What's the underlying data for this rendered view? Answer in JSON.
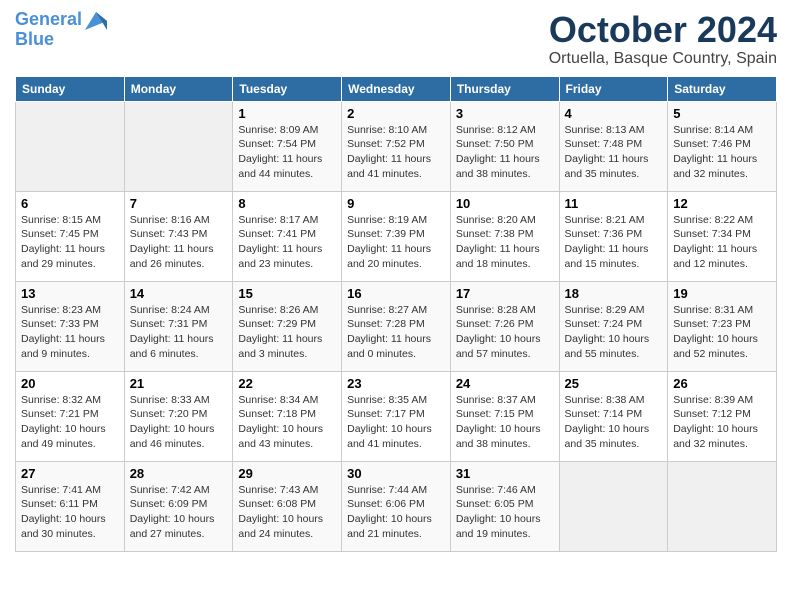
{
  "header": {
    "logo_line1": "General",
    "logo_line2": "Blue",
    "month": "October 2024",
    "location": "Ortuella, Basque Country, Spain"
  },
  "days_of_week": [
    "Sunday",
    "Monday",
    "Tuesday",
    "Wednesday",
    "Thursday",
    "Friday",
    "Saturday"
  ],
  "weeks": [
    [
      {
        "num": "",
        "info": ""
      },
      {
        "num": "",
        "info": ""
      },
      {
        "num": "1",
        "info": "Sunrise: 8:09 AM\nSunset: 7:54 PM\nDaylight: 11 hours and 44 minutes."
      },
      {
        "num": "2",
        "info": "Sunrise: 8:10 AM\nSunset: 7:52 PM\nDaylight: 11 hours and 41 minutes."
      },
      {
        "num": "3",
        "info": "Sunrise: 8:12 AM\nSunset: 7:50 PM\nDaylight: 11 hours and 38 minutes."
      },
      {
        "num": "4",
        "info": "Sunrise: 8:13 AM\nSunset: 7:48 PM\nDaylight: 11 hours and 35 minutes."
      },
      {
        "num": "5",
        "info": "Sunrise: 8:14 AM\nSunset: 7:46 PM\nDaylight: 11 hours and 32 minutes."
      }
    ],
    [
      {
        "num": "6",
        "info": "Sunrise: 8:15 AM\nSunset: 7:45 PM\nDaylight: 11 hours and 29 minutes."
      },
      {
        "num": "7",
        "info": "Sunrise: 8:16 AM\nSunset: 7:43 PM\nDaylight: 11 hours and 26 minutes."
      },
      {
        "num": "8",
        "info": "Sunrise: 8:17 AM\nSunset: 7:41 PM\nDaylight: 11 hours and 23 minutes."
      },
      {
        "num": "9",
        "info": "Sunrise: 8:19 AM\nSunset: 7:39 PM\nDaylight: 11 hours and 20 minutes."
      },
      {
        "num": "10",
        "info": "Sunrise: 8:20 AM\nSunset: 7:38 PM\nDaylight: 11 hours and 18 minutes."
      },
      {
        "num": "11",
        "info": "Sunrise: 8:21 AM\nSunset: 7:36 PM\nDaylight: 11 hours and 15 minutes."
      },
      {
        "num": "12",
        "info": "Sunrise: 8:22 AM\nSunset: 7:34 PM\nDaylight: 11 hours and 12 minutes."
      }
    ],
    [
      {
        "num": "13",
        "info": "Sunrise: 8:23 AM\nSunset: 7:33 PM\nDaylight: 11 hours and 9 minutes."
      },
      {
        "num": "14",
        "info": "Sunrise: 8:24 AM\nSunset: 7:31 PM\nDaylight: 11 hours and 6 minutes."
      },
      {
        "num": "15",
        "info": "Sunrise: 8:26 AM\nSunset: 7:29 PM\nDaylight: 11 hours and 3 minutes."
      },
      {
        "num": "16",
        "info": "Sunrise: 8:27 AM\nSunset: 7:28 PM\nDaylight: 11 hours and 0 minutes."
      },
      {
        "num": "17",
        "info": "Sunrise: 8:28 AM\nSunset: 7:26 PM\nDaylight: 10 hours and 57 minutes."
      },
      {
        "num": "18",
        "info": "Sunrise: 8:29 AM\nSunset: 7:24 PM\nDaylight: 10 hours and 55 minutes."
      },
      {
        "num": "19",
        "info": "Sunrise: 8:31 AM\nSunset: 7:23 PM\nDaylight: 10 hours and 52 minutes."
      }
    ],
    [
      {
        "num": "20",
        "info": "Sunrise: 8:32 AM\nSunset: 7:21 PM\nDaylight: 10 hours and 49 minutes."
      },
      {
        "num": "21",
        "info": "Sunrise: 8:33 AM\nSunset: 7:20 PM\nDaylight: 10 hours and 46 minutes."
      },
      {
        "num": "22",
        "info": "Sunrise: 8:34 AM\nSunset: 7:18 PM\nDaylight: 10 hours and 43 minutes."
      },
      {
        "num": "23",
        "info": "Sunrise: 8:35 AM\nSunset: 7:17 PM\nDaylight: 10 hours and 41 minutes."
      },
      {
        "num": "24",
        "info": "Sunrise: 8:37 AM\nSunset: 7:15 PM\nDaylight: 10 hours and 38 minutes."
      },
      {
        "num": "25",
        "info": "Sunrise: 8:38 AM\nSunset: 7:14 PM\nDaylight: 10 hours and 35 minutes."
      },
      {
        "num": "26",
        "info": "Sunrise: 8:39 AM\nSunset: 7:12 PM\nDaylight: 10 hours and 32 minutes."
      }
    ],
    [
      {
        "num": "27",
        "info": "Sunrise: 7:41 AM\nSunset: 6:11 PM\nDaylight: 10 hours and 30 minutes."
      },
      {
        "num": "28",
        "info": "Sunrise: 7:42 AM\nSunset: 6:09 PM\nDaylight: 10 hours and 27 minutes."
      },
      {
        "num": "29",
        "info": "Sunrise: 7:43 AM\nSunset: 6:08 PM\nDaylight: 10 hours and 24 minutes."
      },
      {
        "num": "30",
        "info": "Sunrise: 7:44 AM\nSunset: 6:06 PM\nDaylight: 10 hours and 21 minutes."
      },
      {
        "num": "31",
        "info": "Sunrise: 7:46 AM\nSunset: 6:05 PM\nDaylight: 10 hours and 19 minutes."
      },
      {
        "num": "",
        "info": ""
      },
      {
        "num": "",
        "info": ""
      }
    ]
  ]
}
